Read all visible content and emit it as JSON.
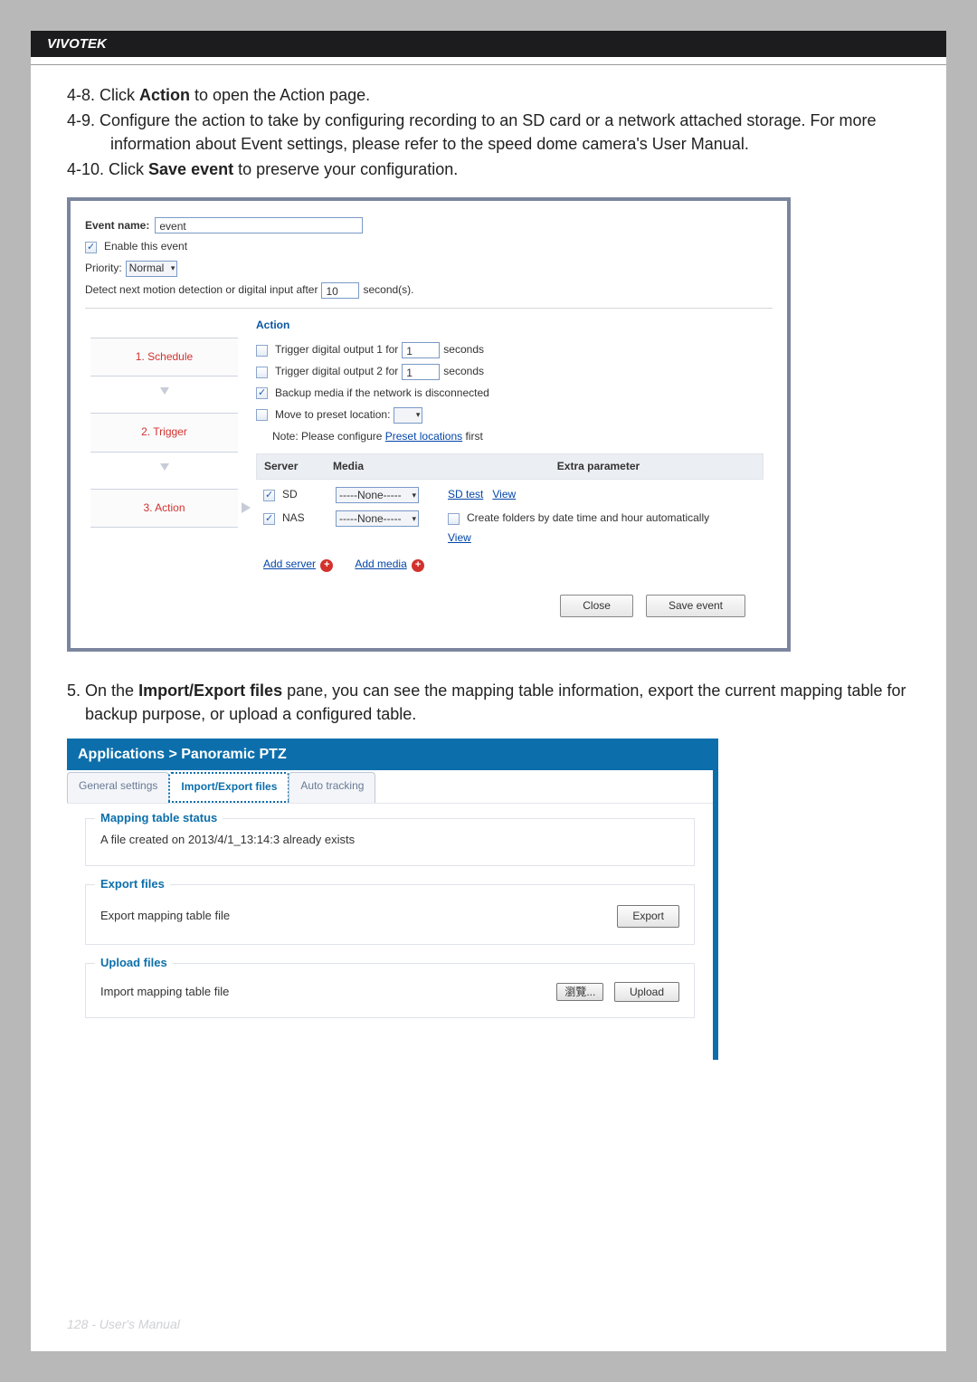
{
  "header": {
    "brand": "VIVOTEK"
  },
  "instructions": {
    "step48_a": "4-8. Click ",
    "step48_b": "Action",
    "step48_c": " to open the Action page.",
    "step49": "4-9. Configure the action to take by configuring recording to an SD card or a network attached storage. For more information about Event settings, please refer to the speed dome camera's User Manual.",
    "step410_a": "4-10. Click ",
    "step410_b": "Save event",
    "step410_c": " to preserve your configuration.",
    "step5_a": "5. On the ",
    "step5_b": "Import/Export files",
    "step5_c": " pane, you can see the mapping table information, export the current mapping table for backup purpose, or upload a configured table."
  },
  "event": {
    "name_label": "Event name:",
    "name_value": "event",
    "enable_label": "Enable this event",
    "priority_label": "Priority:",
    "priority_value": "Normal",
    "detect_prefix": "Detect next motion detection or digital input after",
    "detect_value": "10",
    "detect_suffix": "second(s).",
    "action_title": "Action",
    "trig_out1_label": "Trigger digital output 1 for",
    "trig_out1_val": "1",
    "trig_out1_suffix": "seconds",
    "trig_out2_label": "Trigger digital output 2 for",
    "trig_out2_val": "1",
    "trig_out2_suffix": "seconds",
    "backup_label": "Backup media if the network is disconnected",
    "move_preset_label": "Move to preset location:",
    "note_prefix": "Note: Please configure ",
    "note_link": "Preset locations",
    "note_suffix": " first",
    "hdr_server": "Server",
    "hdr_media": "Media",
    "hdr_extra": "Extra parameter",
    "sd_label": "SD",
    "media_none": "-----None-----",
    "sd_test": "SD test",
    "view": "View",
    "nas_label": "NAS",
    "create_folders": "Create folders by date time and hour automatically",
    "add_server": "Add server",
    "add_media": "Add media",
    "close_btn": "Close",
    "save_btn": "Save event",
    "steps": {
      "s1": "1.  Schedule",
      "s2": "2.  Trigger",
      "s3": "3.  Action"
    }
  },
  "ptz": {
    "breadcrumb": "Applications  >  Panoramic PTZ",
    "tabs": {
      "general": "General settings",
      "import": "Import/Export files",
      "auto": "Auto tracking"
    },
    "status_legend": "Mapping table status",
    "status_text": "A file created on 2013/4/1_13:14:3 already exists",
    "export_legend": "Export files",
    "export_text": "Export mapping table file",
    "export_btn": "Export",
    "upload_legend": "Upload files",
    "upload_text": "Import mapping table file",
    "browse_btn": "瀏覽...",
    "upload_btn": "Upload"
  },
  "footer": "128 - User's Manual"
}
